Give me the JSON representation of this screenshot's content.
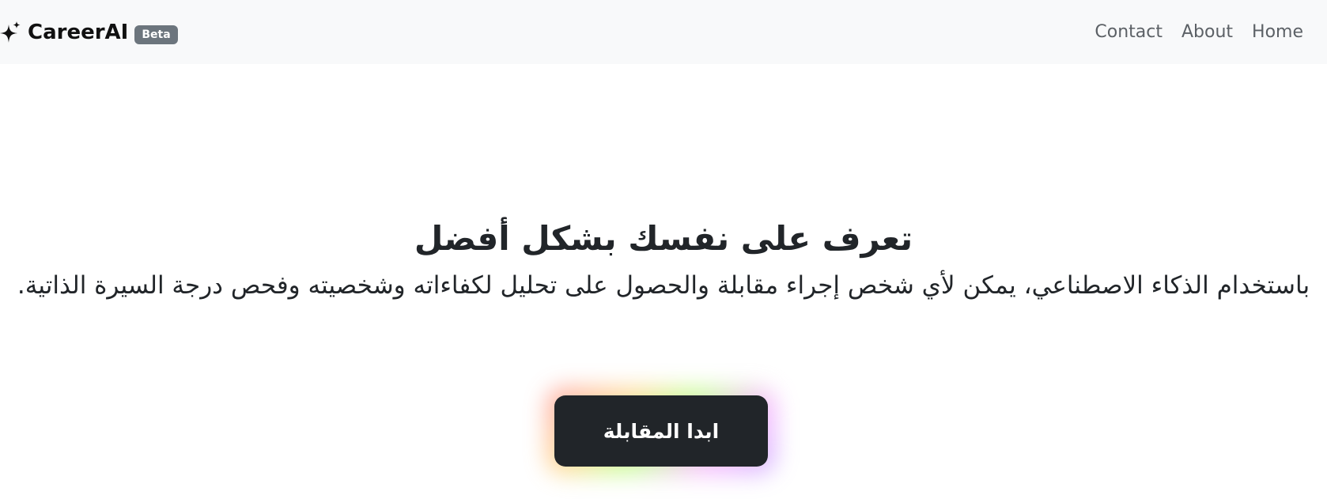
{
  "header": {
    "brand_name": "CareerAI",
    "brand_badge": "Beta",
    "brand_icon": "sparkles-icon",
    "nav": {
      "contact": "Contact",
      "about": "About",
      "home": "Home"
    }
  },
  "hero": {
    "title": "تعرف على نفسك بشكل أفضل",
    "subtitle": "باستخدام الذكاء الاصطناعي، يمكن لأي شخص إجراء مقابلة والحصول على تحليل لكفاءاته وشخصيته وفحص درجة السيرة الذاتية.",
    "cta_label": "ابدا المقابلة"
  },
  "colors": {
    "navbar_bg": "#f8f9fa",
    "badge_bg": "#6c757d",
    "button_bg": "#212529",
    "text": "#212529",
    "nav_link": "#5c6166"
  }
}
